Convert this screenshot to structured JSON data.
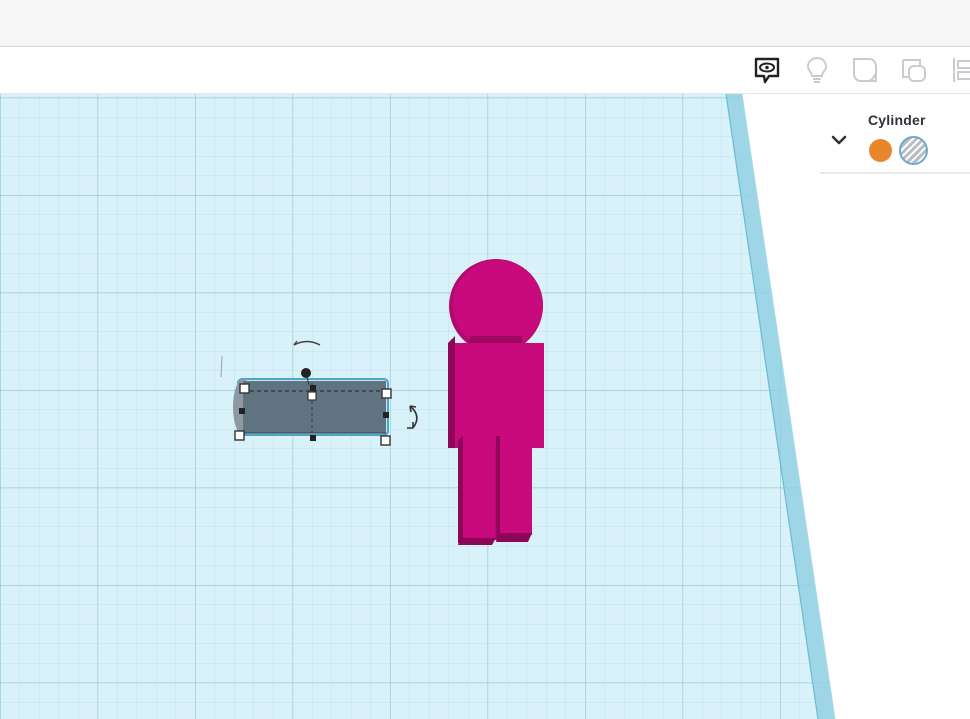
{
  "toolbar": {
    "icons": [
      "comment-eye-icon",
      "lightbulb-icon",
      "note-icon",
      "duplicate-group-icon",
      "align-icon"
    ]
  },
  "shape_panel": {
    "title": "Cylinder",
    "solid_color": "#e8862a",
    "hole_selected": true
  },
  "scene": {
    "grid_color": "#a9d6e5",
    "plane_color": "#d9f1f8",
    "figure_color": "#c80a7d",
    "selected_object_color": "#5f7380"
  }
}
